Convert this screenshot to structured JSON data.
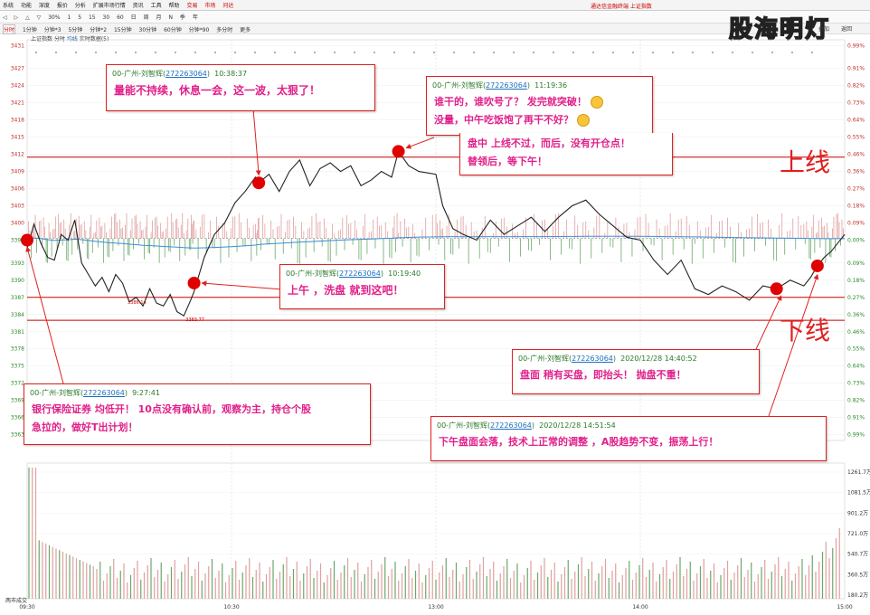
{
  "menu": {
    "items": [
      "系统",
      "功能",
      "深度",
      "报价",
      "分析",
      "扩展市场行情",
      "资讯",
      "工具",
      "帮助"
    ],
    "tabs": [
      "交易",
      "市场",
      "问达"
    ],
    "notice": "通达信金融终端 上证指数"
  },
  "toolbar": {
    "zoom": "30%",
    "periods": [
      "1",
      "5",
      "15",
      "30",
      "60",
      "日",
      "周",
      "月",
      "N",
      "季",
      "年"
    ]
  },
  "timeframes": [
    "分时",
    "1分钟",
    "分钟*3",
    "5分钟",
    "分钟*2",
    "15分钟",
    "30分钟",
    "60分钟",
    "分钟*90",
    "多分时",
    "更多"
  ],
  "active_timeframe": "分时",
  "right_controls": [
    "叠加",
    "返回"
  ],
  "info": {
    "index": "上证指数",
    "mode": "分时",
    "ma_label": "均线",
    "extra": "实时数据(5)"
  },
  "watermark": "股海明灯",
  "chart_data": {
    "type": "line",
    "title": "上证指数 分时",
    "prev_close": 3397.29,
    "y_ticks": [
      3431,
      3427,
      3424,
      3421,
      3418,
      3415,
      3412,
      3409,
      3406,
      3403,
      3400,
      3397,
      3393,
      3390,
      3387,
      3384,
      3381,
      3378,
      3375,
      3372,
      3369,
      3366,
      3363
    ],
    "pct_ticks": [
      "0.99%",
      "0.91%",
      "0.82%",
      "0.73%",
      "0.64%",
      "0.55%",
      "0.46%",
      "0.36%",
      "0.27%",
      "0.18%",
      "0.09%",
      "0.00%",
      "0.09%",
      "0.18%",
      "0.27%",
      "0.36%",
      "0.46%",
      "0.55%",
      "0.64%",
      "0.73%",
      "0.82%",
      "0.91%",
      "0.99%"
    ],
    "ylim": [
      3362,
      3432
    ],
    "x_ticks": [
      "09:30",
      "10:30",
      "13:00",
      "14:00",
      "15:00"
    ],
    "time_points": [
      {
        "t": "09:30",
        "p": 3395.5
      },
      {
        "t": "09:32",
        "p": 3399.8
      },
      {
        "t": "09:34",
        "p": 3396.5
      },
      {
        "t": "09:36",
        "p": 3394.0
      },
      {
        "t": "09:38",
        "p": 3393.5
      },
      {
        "t": "09:40",
        "p": 3398.0
      },
      {
        "t": "09:42",
        "p": 3397.0
      },
      {
        "t": "09:44",
        "p": 3400.5
      },
      {
        "t": "09:46",
        "p": 3393.0
      },
      {
        "t": "09:48",
        "p": 3391.0
      },
      {
        "t": "09:50",
        "p": 3389.0
      },
      {
        "t": "09:52",
        "p": 3390.5
      },
      {
        "t": "09:54",
        "p": 3388.0
      },
      {
        "t": "09:56",
        "p": 3391.0
      },
      {
        "t": "09:58",
        "p": 3389.5
      },
      {
        "t": "10:00",
        "p": 3386.2
      },
      {
        "t": "10:02",
        "p": 3387.0
      },
      {
        "t": "10:04",
        "p": 3385.5
      },
      {
        "t": "10:06",
        "p": 3388.5
      },
      {
        "t": "10:08",
        "p": 3386.0
      },
      {
        "t": "10:10",
        "p": 3385.5
      },
      {
        "t": "10:12",
        "p": 3387.5
      },
      {
        "t": "10:14",
        "p": 3384.5
      },
      {
        "t": "10:16",
        "p": 3383.77
      },
      {
        "t": "10:18",
        "p": 3386.5
      },
      {
        "t": "10:19",
        "p": 3388.0
      },
      {
        "t": "10:22",
        "p": 3394.0
      },
      {
        "t": "10:25",
        "p": 3398.0
      },
      {
        "t": "10:28",
        "p": 3400.0
      },
      {
        "t": "10:31",
        "p": 3403.5
      },
      {
        "t": "10:34",
        "p": 3405.5
      },
      {
        "t": "10:37",
        "p": 3408.0
      },
      {
        "t": "10:38",
        "p": 3407.0
      },
      {
        "t": "10:41",
        "p": 3408.5
      },
      {
        "t": "10:44",
        "p": 3405.5
      },
      {
        "t": "10:47",
        "p": 3409.0
      },
      {
        "t": "10:50",
        "p": 3411.0
      },
      {
        "t": "10:53",
        "p": 3406.5
      },
      {
        "t": "10:56",
        "p": 3409.5
      },
      {
        "t": "10:59",
        "p": 3410.5
      },
      {
        "t": "11:02",
        "p": 3409.0
      },
      {
        "t": "11:05",
        "p": 3410.0
      },
      {
        "t": "11:08",
        "p": 3406.5
      },
      {
        "t": "11:11",
        "p": 3407.5
      },
      {
        "t": "11:14",
        "p": 3409.0
      },
      {
        "t": "11:17",
        "p": 3408.0
      },
      {
        "t": "11:19",
        "p": 3412.5
      },
      {
        "t": "11:22",
        "p": 3410.0
      },
      {
        "t": "11:25",
        "p": 3409.0
      },
      {
        "t": "11:30",
        "p": 3408.5
      },
      {
        "t": "13:02",
        "p": 3403.0
      },
      {
        "t": "13:05",
        "p": 3399.0
      },
      {
        "t": "13:08",
        "p": 3398.0
      },
      {
        "t": "13:12",
        "p": 3397.0
      },
      {
        "t": "13:16",
        "p": 3400.5
      },
      {
        "t": "13:20",
        "p": 3398.0
      },
      {
        "t": "13:24",
        "p": 3399.5
      },
      {
        "t": "13:28",
        "p": 3401.0
      },
      {
        "t": "13:32",
        "p": 3398.5
      },
      {
        "t": "13:36",
        "p": 3401.0
      },
      {
        "t": "13:40",
        "p": 3403.0
      },
      {
        "t": "13:44",
        "p": 3404.0
      },
      {
        "t": "13:48",
        "p": 3401.5
      },
      {
        "t": "13:52",
        "p": 3399.5
      },
      {
        "t": "13:56",
        "p": 3397.5
      },
      {
        "t": "14:00",
        "p": 3397.0
      },
      {
        "t": "14:04",
        "p": 3393.5
      },
      {
        "t": "14:08",
        "p": 3391.0
      },
      {
        "t": "14:12",
        "p": 3393.5
      },
      {
        "t": "14:16",
        "p": 3388.5
      },
      {
        "t": "14:20",
        "p": 3387.5
      },
      {
        "t": "14:24",
        "p": 3389.0
      },
      {
        "t": "14:28",
        "p": 3388.0
      },
      {
        "t": "14:32",
        "p": 3386.5
      },
      {
        "t": "14:36",
        "p": 3389.0
      },
      {
        "t": "14:40",
        "p": 3388.5
      },
      {
        "t": "14:44",
        "p": 3390.0
      },
      {
        "t": "14:48",
        "p": 3389.0
      },
      {
        "t": "14:50",
        "p": 3390.5
      },
      {
        "t": "14:52",
        "p": 3392.5
      },
      {
        "t": "14:54",
        "p": 3394.0
      },
      {
        "t": "14:56",
        "p": 3395.0
      },
      {
        "t": "14:58",
        "p": 3396.5
      },
      {
        "t": "15:00",
        "p": 3398.0
      }
    ],
    "avg_line_label": "均价",
    "low_label": "3383.77",
    "low_marker_label": "3386.14",
    "support_resistance": [
      {
        "name": "上线",
        "value": 3411.5
      },
      {
        "name": "下线",
        "value": 3387.0
      },
      {
        "name": "",
        "value": 3383.0
      }
    ],
    "volume_ticks": [
      "1261.7万",
      "1081.5万",
      "901.2万",
      "721.0万",
      "540.7万",
      "360.5万",
      "180.2万"
    ],
    "volume_label": "两市成交",
    "grid": true,
    "legend": "none"
  },
  "labels": {
    "upper_line": "上线",
    "lower_line": "下线"
  },
  "annotations": [
    {
      "id": "a1",
      "user": "00-广州-刘智辉",
      "qq": "272263064",
      "time": "9:27:41",
      "lines": [
        "银行保险证券 均低开！ 10点没有确认前，观察为主，持仓个股",
        "急拉的，做好T出计划！"
      ]
    },
    {
      "id": "a2",
      "user": "00-广州-刘智辉",
      "qq": "272263064",
      "time": "10:38:37",
      "lines": [
        "量能不持续，休息一会，这一波，太狠了！"
      ]
    },
    {
      "id": "a3",
      "user": "00-广州-刘智辉",
      "qq": "272263064",
      "time": "10:19:40",
      "lines": [
        "上午 ，洗盘 就到这吧！"
      ]
    },
    {
      "id": "a4",
      "user": "00-广州-刘智辉",
      "qq": "272263064",
      "time": "11:19:36",
      "lines": [
        "谁干的，谁吹号了？ 发完就突破！",
        "没量，中午吃饭饱了再干不好？"
      ]
    },
    {
      "id": "a4b",
      "lines": [
        "盘中 上线不过，而后，没有开仓点！",
        "替领后，等下午！"
      ]
    },
    {
      "id": "a5",
      "user": "00-广州-刘智辉",
      "qq": "272263064",
      "time": "2020/12/28 14:40:52",
      "lines": [
        "盘面 稍有买盘，即抬头！ 抛盘不重！"
      ]
    },
    {
      "id": "a6",
      "user": "00-广州-刘智辉",
      "qq": "272263064",
      "time": "2020/12/28 14:51:54",
      "lines": [
        "下午盘面会落，技术上正常的调整 ，A股趋势不变，振荡上行！"
      ]
    }
  ],
  "colors": {
    "price_line": "#222222",
    "avg_line": "#3a8fd8",
    "up_bar": "#e0a0a0",
    "down_bar": "#6aa86a",
    "annotation_border": "#e02020",
    "annotation_text": "#e0208a",
    "marker": "#e00000"
  }
}
